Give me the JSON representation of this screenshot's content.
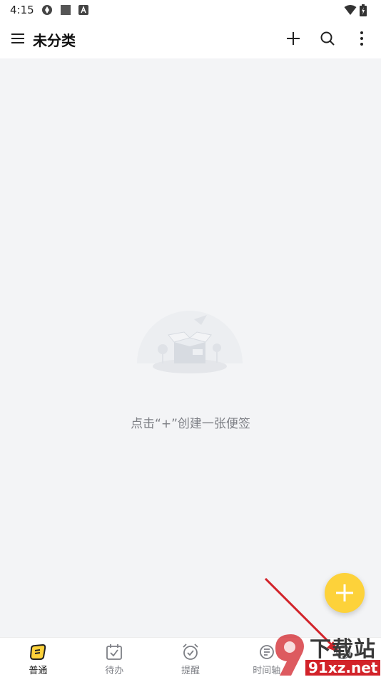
{
  "status_bar": {
    "time": "4:15"
  },
  "app_bar": {
    "title": "未分类"
  },
  "empty_state": {
    "hint": "点击“+”创建一张便签"
  },
  "bottom_nav": {
    "items": [
      {
        "label": "普通",
        "icon": "note-icon",
        "active": true
      },
      {
        "label": "待办",
        "icon": "calendar-check-icon",
        "active": false
      },
      {
        "label": "提醒",
        "icon": "alarm-clock-icon",
        "active": false
      },
      {
        "label": "时间轴",
        "icon": "timeline-icon",
        "active": false
      },
      {
        "label": "",
        "icon": "more-tab-icon",
        "active": false
      }
    ]
  },
  "watermark": {
    "top": "下载站",
    "bottom": "91xz.net"
  },
  "colors": {
    "accent": "#fdd23a",
    "background": "#f3f4f6",
    "hint_text": "#7d7f85",
    "arrow": "#d2232a"
  }
}
